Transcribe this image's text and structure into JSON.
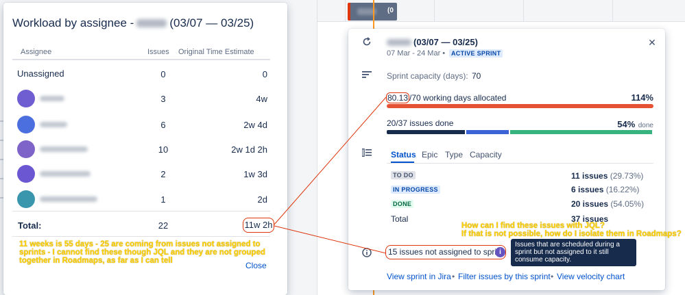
{
  "workload": {
    "title_prefix": "Workload by assignee -",
    "title_suffix": "(03/07 — 03/25)",
    "columns": {
      "assignee": "Assignee",
      "issues": "Issues",
      "estimate": "Original Time Estimate"
    },
    "rows": [
      {
        "name": "Unassigned",
        "issues": "0",
        "estimate": "0",
        "avatar_color": ""
      },
      {
        "name": "",
        "issues": "3",
        "estimate": "4w",
        "avatar_color": "#6f5ed1"
      },
      {
        "name": "",
        "issues": "6",
        "estimate": "2w 4d",
        "avatar_color": "#4c6fe0"
      },
      {
        "name": "",
        "issues": "10",
        "estimate": "2w 1d 2h",
        "avatar_color": "#7e63c9"
      },
      {
        "name": "",
        "issues": "2",
        "estimate": "1w 3d",
        "avatar_color": "#6b57d1"
      },
      {
        "name": "",
        "issues": "1",
        "estimate": "2d",
        "avatar_color": "#3a96ad"
      }
    ],
    "total_label": "Total",
    "total_issues": "22",
    "total_estimate": "11w 2h",
    "close_label": "Close"
  },
  "sprint": {
    "title_suffix": "(03/07 — 03/25)",
    "dates": "07 Mar - 24 Mar •",
    "badge": "ACTIVE SPRINT",
    "capacity_label": "Sprint capacity (days):",
    "capacity_value": "70",
    "allocated_value": "80.13",
    "allocated_text": "/70 working days allocated",
    "allocated_percent": "114%",
    "done_text": "20/37 issues done",
    "done_percent": "54%",
    "done_suffix": "done",
    "tabs": [
      "Status",
      "Epic",
      "Type",
      "Capacity"
    ],
    "statuses": [
      {
        "label": "TO DO",
        "count": "11 issues",
        "pct": "(29.73%)"
      },
      {
        "label": "IN PROGRESS",
        "count": "6 issues",
        "pct": "(16.22%)"
      },
      {
        "label": "DONE",
        "count": "20 issues",
        "pct": "(54.05%)"
      }
    ],
    "total_label": "Total",
    "total_count": "37 issues",
    "not_assigned": "15 issues not assigned to sprint",
    "help_glyph": "i",
    "tooltip": "Issues that are scheduled during a sprint but not assigned to it still consume capacity.",
    "links": [
      "View sprint in Jira",
      "Filter issues by this sprint",
      "View velocity chart"
    ],
    "link_separator": "•",
    "close_glyph": "✕",
    "colors": {
      "allocated_bar": "#e55334",
      "todo_bar": "#172b4d",
      "inprogress_bar": "#3b63d6",
      "done_bar": "#36b37e"
    },
    "done_bar_fractions": {
      "todo": 0.2973,
      "inprogress": 0.1622,
      "done": 0.5405
    }
  },
  "timeline": {
    "chip_suffix": "(0"
  },
  "annotations": {
    "left": "11 weeks is 55 days - 25 are coming from issues not assigned to\nsprints - I cannot find these though JQL and they are not grouped\ntogether in Roadmaps, as far as I can tell",
    "right": "How can I find these issues with JQL?\nIf that is not possible, how do I isolate them in Roadmaps?"
  }
}
